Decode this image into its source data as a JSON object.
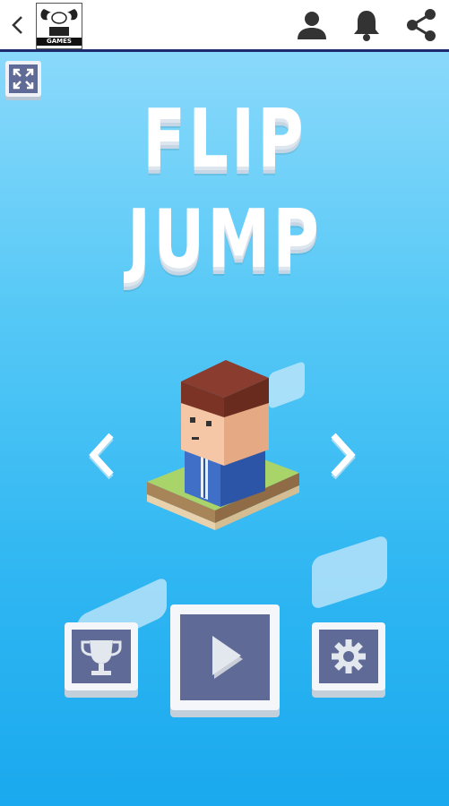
{
  "app_bar": {
    "back_icon": "chevron-left-icon",
    "logo_text": "GAMES",
    "icons": [
      "user-icon",
      "bell-icon",
      "share-icon"
    ]
  },
  "game": {
    "title_line1": "FLIP",
    "title_line2": "JUMP",
    "buttons": {
      "leaderboard": "trophy-icon",
      "play": "play-icon",
      "settings": "gear-icon",
      "fullscreen": "expand-icon"
    },
    "colors": {
      "sky_top": "#8ad9fb",
      "sky_bottom": "#1aa9ee",
      "button_face": "#5f6b96",
      "button_frame": "#f4f6f9"
    }
  }
}
